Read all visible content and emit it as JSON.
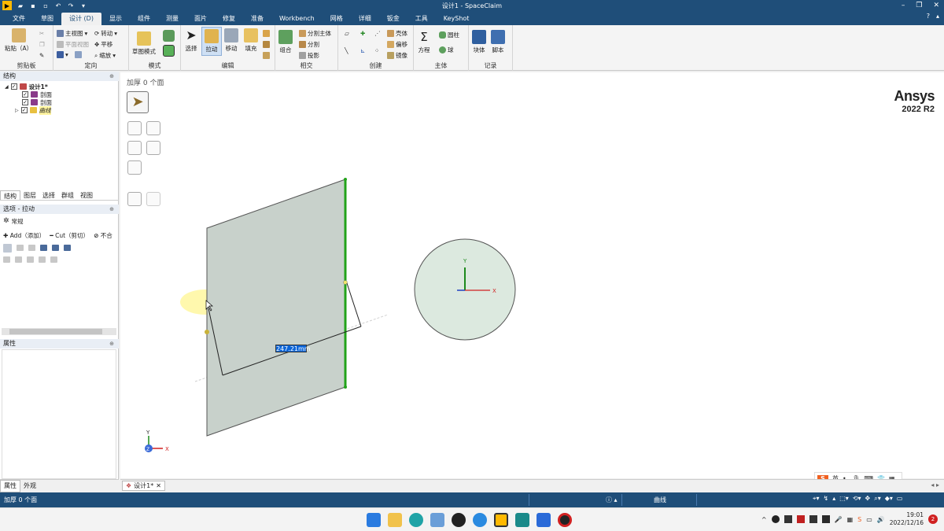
{
  "window": {
    "title": "设计1 - SpaceClaim",
    "logo_text": "▶"
  },
  "menu": {
    "tabs": [
      "文件",
      "草图",
      "设计 (D)",
      "显示",
      "组件",
      "测量",
      "面片",
      "修复",
      "准备",
      "Workbench",
      "网格",
      "详细",
      "钣金",
      "工具",
      "KeyShot"
    ],
    "active_index": 2
  },
  "ribbon": {
    "clipboard": {
      "label": "剪贴板",
      "paste": "粘贴（A）"
    },
    "orient": {
      "label": "定向",
      "home": "主视图",
      "plan": "平面视图",
      "rotate": "转动",
      "pan": "平移",
      "zoom": "缩放"
    },
    "mode": {
      "label": "模式",
      "sketch_mode": "草图模式"
    },
    "edit": {
      "label": "编辑",
      "select": "选择",
      "pull": "拉动",
      "move": "移动",
      "fill": "填充"
    },
    "intersect": {
      "label": "相交",
      "combine": "组合",
      "split_body": "分割主体",
      "split": "分割",
      "project": "投影"
    },
    "create": {
      "label": "创建",
      "shell": "壳体",
      "offset": "偏移",
      "mirror": "镜像"
    },
    "body": {
      "label": "主体",
      "equation": "方程",
      "cylinder": "圆柱",
      "sphere": "球"
    },
    "record": {
      "label": "记录",
      "block": "块体",
      "script": "脚本"
    }
  },
  "structure_panel": {
    "header": "结构",
    "tree": [
      {
        "label": "设计1*",
        "bold": true
      },
      {
        "label": "剖面"
      },
      {
        "label": "剖面"
      },
      {
        "label": "曲线",
        "italic": true
      }
    ]
  },
  "panel_tabs": [
    "结构",
    "图层",
    "选择",
    "群组",
    "视图"
  ],
  "options_panel": {
    "header": "选项 - 拉动",
    "section": "常规",
    "add": "Add（添加）",
    "cut": "Cut（剪切）",
    "no_merge": "不合"
  },
  "properties_panel": {
    "header": "属性"
  },
  "bottom_tabs": [
    "属性",
    "外观"
  ],
  "viewport": {
    "status_label": "加厚 0 个面",
    "brand": "Ansys",
    "version": "2022 R2",
    "dimension": "247.21mm",
    "axis_x": "X",
    "axis_y": "Y",
    "axis_z": "Z"
  },
  "doc_tab": {
    "label": "设计1*"
  },
  "statusbar": {
    "left": "加厚 0 个面",
    "selection_type": "曲线"
  },
  "ime": {
    "lang": "英"
  },
  "clock": {
    "time": "19:01",
    "date": "2022/12/16"
  },
  "notification_count": "2",
  "colors": {
    "brand_blue": "#1f4e79",
    "face_fill": "#c8d1cb",
    "edge_green": "#22a31a",
    "circle_fill": "#dce9df"
  }
}
